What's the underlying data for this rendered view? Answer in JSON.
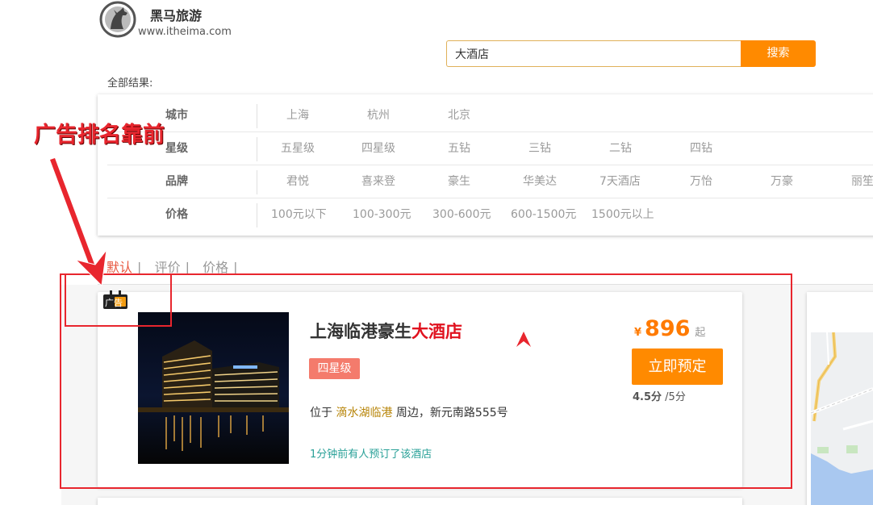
{
  "header": {
    "brand_name": "黑马旅游",
    "brand_url": "www.itheima.com"
  },
  "search": {
    "value": "大酒店",
    "button_label": "搜索"
  },
  "results_label": "全部结果:",
  "filters": [
    {
      "label": "城市",
      "options": [
        "上海",
        "杭州",
        "北京"
      ]
    },
    {
      "label": "星级",
      "options": [
        "五星级",
        "四星级",
        "五钻",
        "三钻",
        "二钻",
        "四钻"
      ]
    },
    {
      "label": "品牌",
      "options": [
        "君悦",
        "喜来登",
        "豪生",
        "华美达",
        "7天酒店",
        "万怡",
        "万豪",
        "丽笙"
      ]
    },
    {
      "label": "价格",
      "options": [
        "100元以下",
        "100-300元",
        "300-600元",
        "600-1500元",
        "1500元以上"
      ]
    }
  ],
  "sort": {
    "items": [
      "默认",
      "评价",
      "价格"
    ],
    "separator": "|",
    "active": "默认"
  },
  "annotation": {
    "text": "广告排名靠前"
  },
  "hotel": {
    "ad_label": "广告",
    "name_prefix": "上海临港豪生",
    "name_highlight": "大酒店",
    "star_tag": "四星级",
    "location_prefix": "位于",
    "location_area": "滴水湖临港",
    "location_suffix": "周边，新元南路555号",
    "booked_note": "1分钟前有人预订了该酒店",
    "currency": "¥",
    "price": "896",
    "price_suffix": "起",
    "book_label": "立即预定",
    "score": "4.5分",
    "score_total": "/5分"
  },
  "colors": {
    "accent": "#ff8a00",
    "annotation_red": "#e8262e",
    "highlight_red": "#e0121f",
    "star_tag": "#f47b6c",
    "note_green": "#2aa198"
  }
}
